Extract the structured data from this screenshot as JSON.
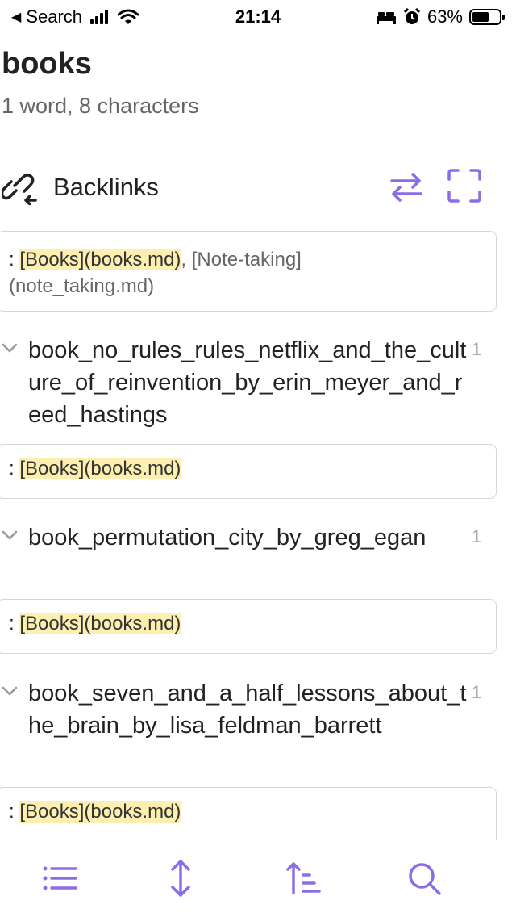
{
  "status_bar": {
    "back_label": "Search",
    "time": "21:14",
    "battery_pct": "63%",
    "battery_level": 0.63,
    "icons": [
      "signal-icon",
      "wifi-icon",
      "bed-icon",
      "alarm-icon",
      "battery-icon"
    ]
  },
  "note": {
    "title": "books",
    "stats": "1 word, 8 characters"
  },
  "backlinks": {
    "title": "Backlinks",
    "icons": [
      "backlink-icon",
      "swap-icon",
      "expand-icon"
    ],
    "accent": "#8b6ee6",
    "intro_card": {
      "prefix": ": ",
      "link1": "[Books](books.md)",
      "sep": ", ",
      "link2_line1": "[Note-taking]",
      "link2_line2": "(note_taking.md)"
    },
    "groups": [
      {
        "title": "book_no_rules_rules_netflix_and_the_culture_of_reinvention_by_erin_meyer_and_reed_hastings",
        "count": "1",
        "snippet_prefix": ": ",
        "snippet_link": "[Books](books.md)"
      },
      {
        "title": "book_permutation_city_by_greg_egan",
        "count": "1",
        "snippet_prefix": ": ",
        "snippet_link": "[Books](books.md)"
      },
      {
        "title": "book_seven_and_a_half_lessons_about_the_brain_by_lisa_feldman_barrett",
        "count": "1",
        "snippet_prefix": ": ",
        "snippet_link": "[Books](books.md)"
      }
    ]
  },
  "toolbar": {
    "icons": [
      "list-icon",
      "vertical-arrows-icon",
      "sort-icon",
      "search-icon"
    ]
  }
}
